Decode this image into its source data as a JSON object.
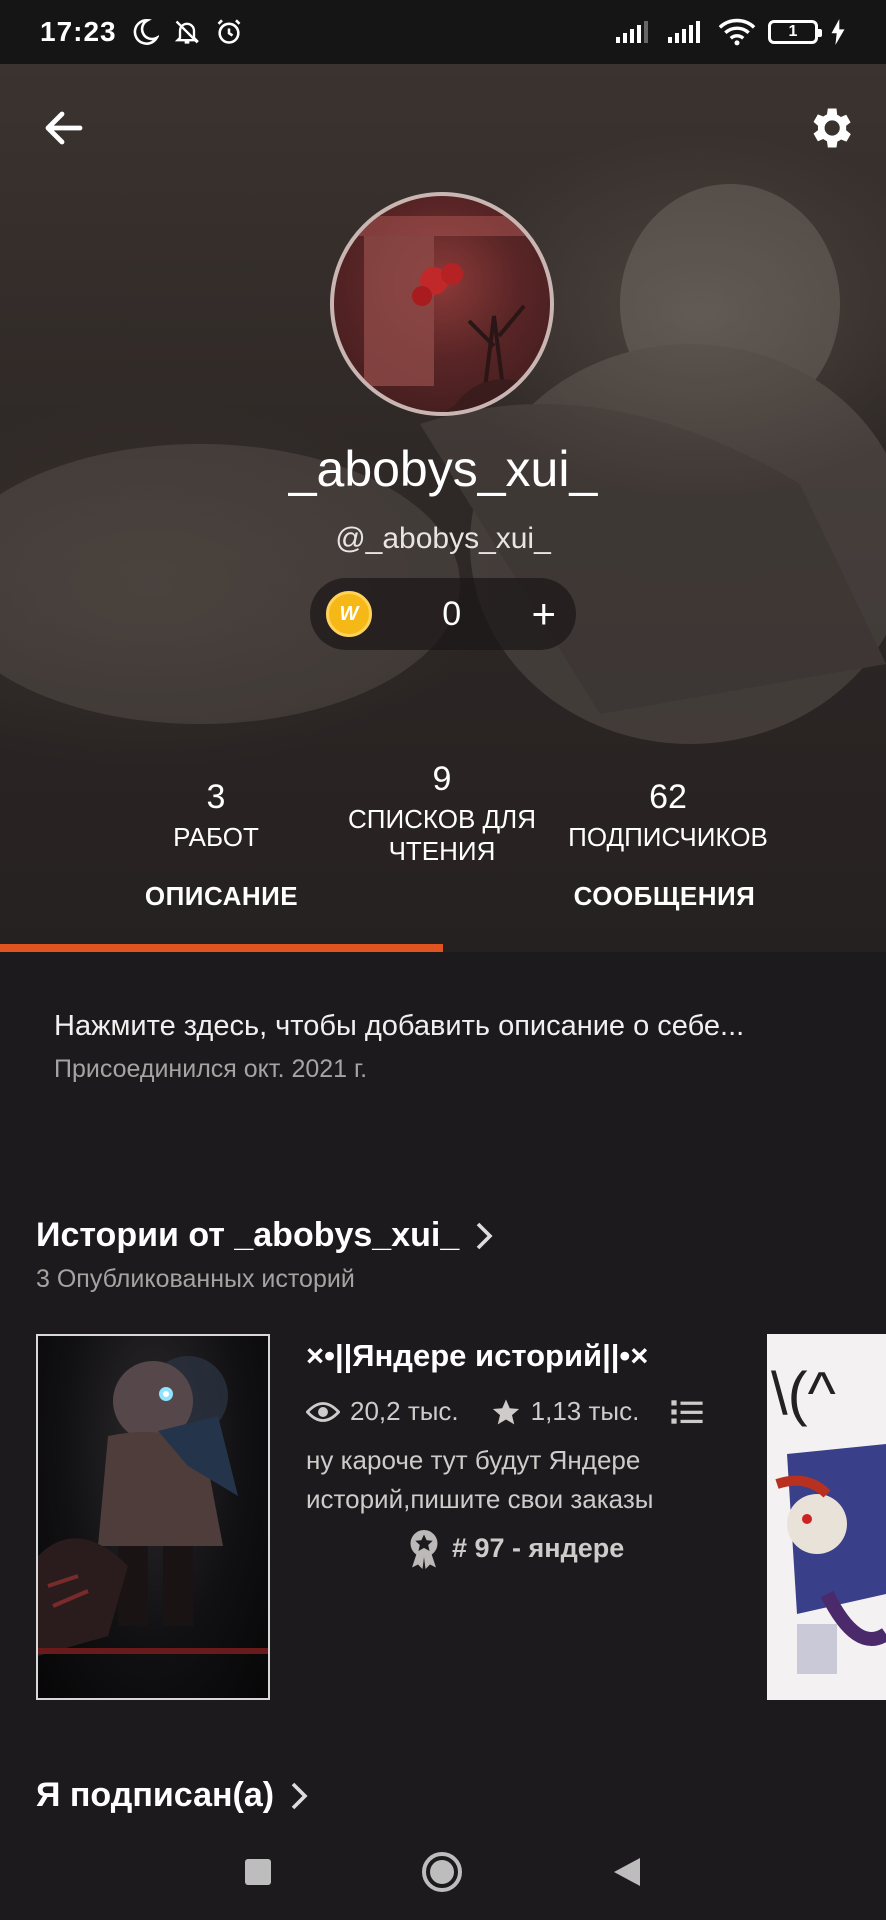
{
  "status_bar": {
    "time": "17:23",
    "battery": "1",
    "icons": [
      "moon-icon",
      "bell-off-icon",
      "alarm-icon",
      "signal-icon",
      "signal-icon",
      "wifi-icon",
      "battery-icon",
      "charging-icon"
    ]
  },
  "profile": {
    "display_name": "_abobys_xui_",
    "username": "@_abobys_xui_",
    "coins": "0",
    "coin_symbol": "W",
    "add_symbol": "+"
  },
  "stats": {
    "works": {
      "value": "3",
      "label": "РАБОТ"
    },
    "reading_lists": {
      "value": "9",
      "label": "СПИСКОВ ДЛЯ ЧТЕНИЯ"
    },
    "followers": {
      "value": "62",
      "label": "ПОДПИСЧИКОВ"
    }
  },
  "tabs": {
    "about": "ОПИСАНИЕ",
    "messages": "СООБЩЕНИЯ",
    "active": "about"
  },
  "about": {
    "prompt": "Нажмите здесь, чтобы добавить описание о себе...",
    "joined": "Присоединился окт. 2021 г."
  },
  "stories": {
    "title": "Истории от _abobys_xui_",
    "subtitle": "3 Опубликованных историй",
    "items": [
      {
        "title": "×•||Яндере историй||•×",
        "views": "20,2 тыс.",
        "votes": "1,13 тыс.",
        "description": "ну кароче тут будут Яндере историй,пишите свои заказы",
        "rank": "# 97 - яндере"
      }
    ]
  },
  "following": {
    "title": "Я подписан(а)"
  },
  "colors": {
    "accent": "#e0541f",
    "background": "#1c1a1c",
    "coin": "#f5b817"
  }
}
